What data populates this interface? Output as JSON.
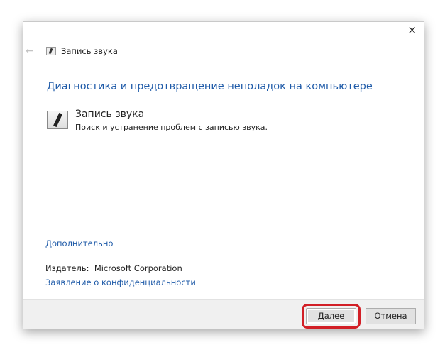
{
  "window": {
    "title": "Запись звука",
    "close_icon": "×",
    "back_icon": "←"
  },
  "main": {
    "heading": "Диагностика и предотвращение неполадок на компьютере",
    "item_title": "Запись звука",
    "item_description": "Поиск и устранение проблем с записью звука.",
    "advanced_link": "Дополнительно",
    "publisher_label": "Издатель:",
    "publisher_value": "Microsoft Corporation",
    "privacy_link": "Заявление о конфиденциальности"
  },
  "footer": {
    "next_label": "Далее",
    "cancel_label": "Отмена"
  },
  "colors": {
    "link": "#1e5aa8",
    "highlight": "#d21f26"
  }
}
